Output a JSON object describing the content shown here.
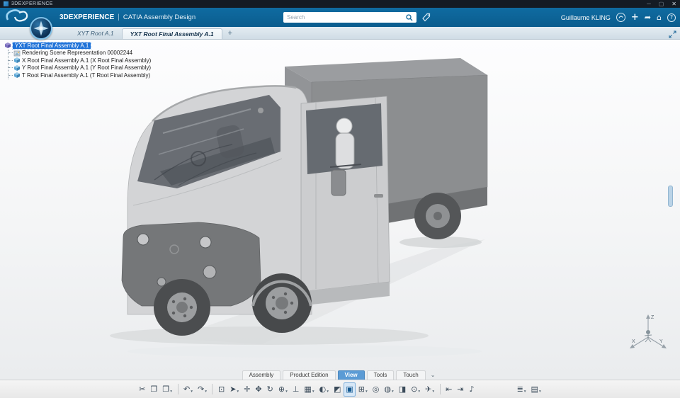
{
  "window": {
    "title": "3DEXPERIENCE",
    "minimize": "─",
    "maximize": "▢",
    "close": "✕"
  },
  "header": {
    "brand": "3DEXPERIENCE",
    "divider": "|",
    "app": "CATIA Assembly Design",
    "search_placeholder": "Search",
    "user_name": "Guillaume KLING",
    "add": "+",
    "share": "➦",
    "home": "⌂",
    "help": "?"
  },
  "tabbar": {
    "tabs": [
      {
        "label": "XYT Root A.1"
      },
      {
        "label": "YXT Root Final Assembly A.1",
        "active": true
      }
    ],
    "add": "+"
  },
  "tree": {
    "items": [
      {
        "label": "YXT Root Final Assembly A.1",
        "selected": true
      },
      {
        "label": "Rendering Scene Representation 00002244"
      },
      {
        "label": "X Root Final Assembly A.1 (X Root Final Assembly)"
      },
      {
        "label": "Y Root Final Assembly A.1 (Y Root Final Assembly)"
      },
      {
        "label": "T Root Final Assembly A.1 (T Root Final Assembly)"
      }
    ]
  },
  "viewport": {
    "triad": {
      "x": "X",
      "y": "Y",
      "z": "Z"
    }
  },
  "actionbar": {
    "chevron": "⌄",
    "tabs": [
      {
        "label": "Assembly"
      },
      {
        "label": "Product Edition"
      },
      {
        "label": "View",
        "active": true
      },
      {
        "label": "Tools"
      },
      {
        "label": "Touch"
      }
    ],
    "toolbar": [
      {
        "name": "cut",
        "glyph": "✂"
      },
      {
        "name": "copy",
        "glyph": "❐"
      },
      {
        "name": "paste",
        "glyph": "❒",
        "caret": true
      },
      {
        "name": "undo",
        "glyph": "↶",
        "caret": true
      },
      {
        "name": "redo",
        "glyph": "↷",
        "caret": true
      },
      {
        "name": "zoom-area",
        "glyph": "⊡"
      },
      {
        "name": "select",
        "glyph": "➤",
        "caret": true
      },
      {
        "name": "fit-all",
        "glyph": "✛"
      },
      {
        "name": "pan",
        "glyph": "✥"
      },
      {
        "name": "rotate",
        "glyph": "↻"
      },
      {
        "name": "zoom",
        "glyph": "⊕",
        "caret": true
      },
      {
        "name": "normal-view",
        "glyph": "⊥"
      },
      {
        "name": "views",
        "glyph": "▦",
        "caret": true
      },
      {
        "name": "render-style",
        "glyph": "◐",
        "caret": true
      },
      {
        "name": "section",
        "glyph": "◩"
      },
      {
        "name": "shading",
        "glyph": "▣",
        "active": true
      },
      {
        "name": "grid",
        "glyph": "⊞",
        "caret": true
      },
      {
        "name": "compass",
        "glyph": "◎"
      },
      {
        "name": "hide-show",
        "glyph": "◍",
        "caret": true
      },
      {
        "name": "swap-space",
        "glyph": "◨"
      },
      {
        "name": "capture",
        "glyph": "⊙",
        "caret": true
      },
      {
        "name": "fly",
        "glyph": "✈",
        "caret": true
      },
      {
        "name": "rewind",
        "glyph": "⇤"
      },
      {
        "name": "forward",
        "glyph": "⇥"
      },
      {
        "name": "turntable",
        "glyph": "♪"
      },
      {
        "name": "tree-options",
        "glyph": "≣",
        "caret": true
      },
      {
        "name": "window-layout",
        "glyph": "▤",
        "caret": true
      }
    ]
  },
  "ui": {
    "caret": "▾"
  },
  "colors": {
    "header_blue": "#0d6499",
    "selection_blue": "#1f72d8",
    "active_tab_blue": "#5b9bd5",
    "toolbar_active": "#d6e7f7",
    "model_gray": "#8c8e90"
  }
}
